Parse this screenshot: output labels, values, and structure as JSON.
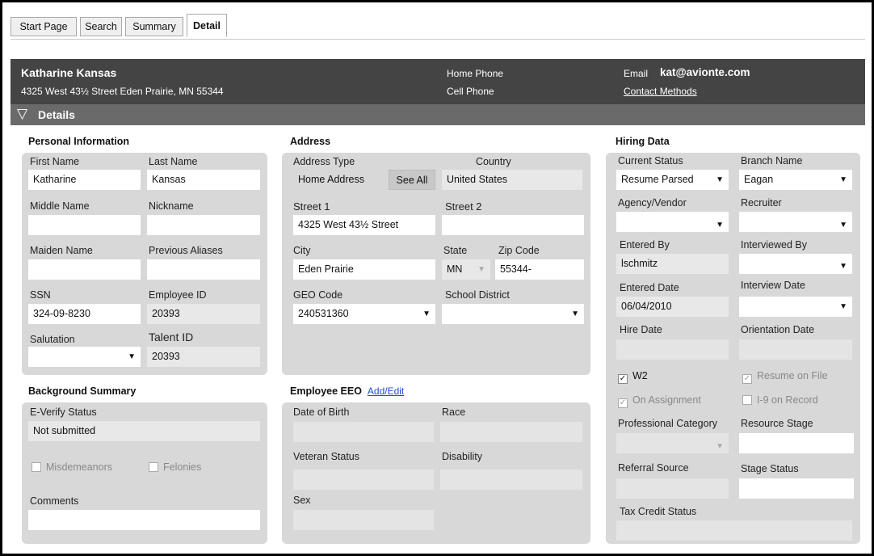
{
  "tabs": [
    {
      "label": "Start Page"
    },
    {
      "label": "Search"
    },
    {
      "label": "Summary"
    },
    {
      "label": "Detail"
    }
  ],
  "header": {
    "name": "Katharine Kansas",
    "address": "4325 West 43½ Street Eden Prairie, MN 55344",
    "home_phone_label": "Home Phone",
    "cell_phone_label": "Cell Phone",
    "email_label": "Email",
    "email_value": "kat@avionte.com",
    "contact_methods": "Contact Methods"
  },
  "details_bar": {
    "label": "Details",
    "icon": "triangle-down-icon"
  },
  "personal": {
    "title": "Personal Information",
    "first_name_label": "First Name",
    "first_name": "Katharine",
    "last_name_label": "Last Name",
    "last_name": "Kansas",
    "middle_name_label": "Middle Name",
    "middle_name": "",
    "nickname_label": "Nickname",
    "nickname": "",
    "maiden_name_label": "Maiden Name",
    "maiden_name": "",
    "previous_aliases_label": "Previous Aliases",
    "previous_aliases": "",
    "ssn_label": "SSN",
    "ssn": "324-09-8230",
    "employee_id_label": "Employee ID",
    "employee_id": "20393",
    "salutation_label": "Salutation",
    "salutation": "",
    "talent_id_label": "Talent ID",
    "talent_id": "20393"
  },
  "address": {
    "title": "Address",
    "address_type_label": "Address Type",
    "address_type": "Home Address",
    "see_all": "See All",
    "country_label": "Country",
    "country": "United States",
    "street1_label": "Street 1",
    "street1": "4325 West 43½ Street",
    "street2_label": "Street 2",
    "street2": "",
    "city_label": "City",
    "city": "Eden Prairie",
    "state_label": "State",
    "state": "MN",
    "zip_label": "Zip Code",
    "zip": "55344-",
    "geo_label": "GEO Code",
    "geo": "240531360",
    "school_label": "School District",
    "school": ""
  },
  "hiring": {
    "title": "Hiring Data",
    "current_status_label": "Current Status",
    "current_status": "Resume Parsed",
    "branch_label": "Branch Name",
    "branch": "Eagan",
    "agency_label": "Agency/Vendor",
    "agency": "",
    "recruiter_label": "Recruiter",
    "recruiter": "",
    "entered_by_label": "Entered By",
    "entered_by": "lschmitz",
    "interviewed_by_label": "Interviewed By",
    "interviewed_by": "",
    "entered_date_label": "Entered Date",
    "entered_date": "06/04/2010",
    "interview_date_label": "Interview Date",
    "interview_date": "",
    "hire_date_label": "Hire Date",
    "hire_date": "",
    "orientation_date_label": "Orientation Date",
    "orientation_date": "",
    "w2_label": "W2",
    "w2_checked": true,
    "resume_on_file_label": "Resume on File",
    "resume_on_file_checked": true,
    "on_assignment_label": "On Assignment",
    "on_assignment_checked": true,
    "i9_label": "I-9 on Record",
    "i9_checked": false,
    "professional_category_label": "Professional Category",
    "professional_category": "",
    "resource_stage_label": "Resource Stage",
    "resource_stage": "",
    "referral_source_label": "Referral Source",
    "referral_source": "",
    "stage_status_label": "Stage Status",
    "stage_status": "",
    "tax_credit_label": "Tax Credit Status",
    "tax_credit": ""
  },
  "background": {
    "title": "Background Summary",
    "everify_label": "E-Verify Status",
    "everify": "Not submitted",
    "misdemeanors_label": "Misdemeanors",
    "misdemeanors_checked": false,
    "felonies_label": "Felonies",
    "felonies_checked": false,
    "comments_label": "Comments",
    "comments": ""
  },
  "eeo": {
    "title": "Employee EEO",
    "add_edit": "Add/Edit",
    "dob_label": "Date of Birth",
    "dob": "",
    "race_label": "Race",
    "race": "",
    "veteran_label": "Veteran Status",
    "veteran": "",
    "disability_label": "Disability",
    "disability": "",
    "sex_label": "Sex",
    "sex": ""
  },
  "glyphs": {
    "dropdown": "▼",
    "check": "✓",
    "details_toggle": "▽"
  }
}
